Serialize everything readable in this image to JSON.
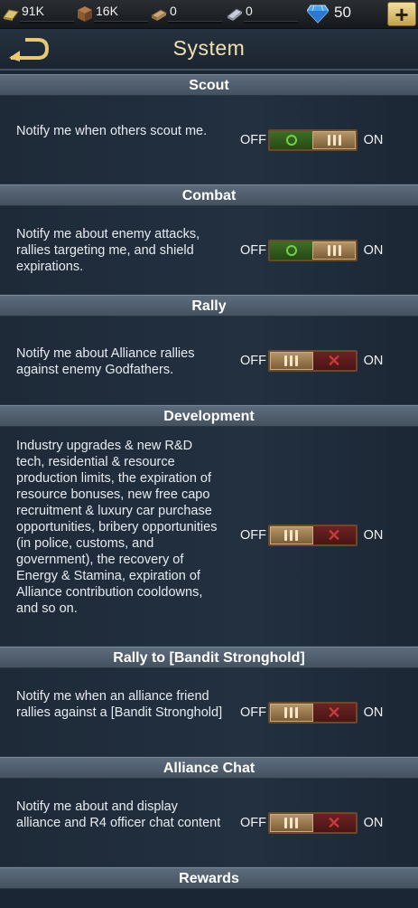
{
  "resources": [
    {
      "icon": "gold-bar-icon",
      "value": "91K"
    },
    {
      "icon": "crate-icon",
      "value": "16K"
    },
    {
      "icon": "cash-stack-icon",
      "value": "0"
    },
    {
      "icon": "ingot-icon",
      "value": "0"
    }
  ],
  "gems": {
    "icon": "diamond-icon",
    "value": "50"
  },
  "header": {
    "title": "System",
    "back_icon": "back-arrow-icon",
    "plus_label": "+"
  },
  "toggle_labels": {
    "off": "OFF",
    "on": "ON"
  },
  "sections": [
    {
      "title": "Scout",
      "description": "Notify me when others scout me.",
      "state": "on"
    },
    {
      "title": "Combat",
      "description": "Notify me about enemy attacks, rallies targeting me, and shield expirations.",
      "state": "on"
    },
    {
      "title": "Rally",
      "description": "Notify me about Alliance rallies against enemy Godfathers.",
      "state": "off"
    },
    {
      "title": "Development",
      "description": "Industry upgrades & new R&D tech, residential & resource production limits, the expiration of resource bonuses, new free capo recruitment & luxury car purchase opportunities, bribery opportunities (in police, customs, and government), the recovery of Energy & Stamina, expiration of Alliance contribution cooldowns, and so on.",
      "state": "off"
    },
    {
      "title": "Rally to [Bandit Stronghold]",
      "description": "Notify me when an alliance friend rallies against a [Bandit Stronghold]",
      "state": "off"
    },
    {
      "title": "Alliance Chat",
      "description": "Notify me about and display alliance and R4 officer chat content",
      "state": "off"
    },
    {
      "title": "Rewards",
      "description": "",
      "state": ""
    }
  ],
  "colors": {
    "accent_gold": "#f0e0b0",
    "toggle_on": "#3f6e26",
    "toggle_off": "#6b2222"
  }
}
